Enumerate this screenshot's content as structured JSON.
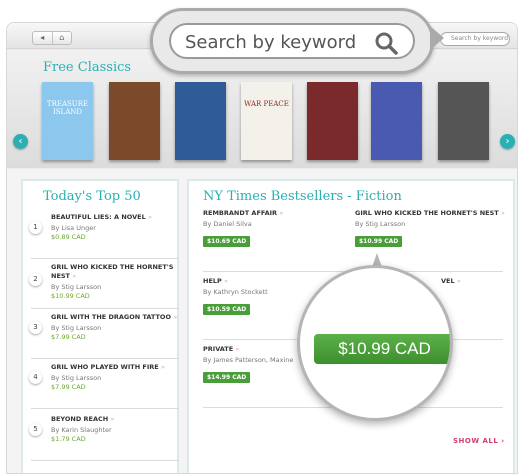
{
  "toolbar": {
    "nav_back": "◂",
    "nav_home": "⌂",
    "mini_search_placeholder": "Search by keyword"
  },
  "classics": {
    "title": "Free Classics",
    "books": [
      {
        "name": "book-cover-treasure-island",
        "text": "TREASURE ISLAND",
        "color": "#8cc7ee"
      },
      {
        "name": "book-cover-landscape",
        "text": "",
        "color": "#7a4a2a"
      },
      {
        "name": "book-cover-blue",
        "text": "",
        "color": "#2f5c97"
      },
      {
        "name": "book-cover-war-and-peace",
        "text": "WAR PEACE",
        "color": "#f4f1ea"
      },
      {
        "name": "book-cover-red-pattern",
        "text": "",
        "color": "#7a2a2a"
      },
      {
        "name": "book-cover-mosaic",
        "text": "",
        "color": "#4a5ab0"
      },
      {
        "name": "book-cover-camera-girl",
        "text": "",
        "color": "#555555"
      }
    ]
  },
  "top50": {
    "title": "Today's Top 50",
    "items": [
      {
        "num": "1",
        "title": "BEAUTIFUL LIES: A NOVEL",
        "author": "By Lisa Unger",
        "price": "$0.89 CAD"
      },
      {
        "num": "2",
        "title": "GRIL WHO KICKED THE HORNET'S NEST",
        "author": "By Stig Larsson",
        "price": "$10.99 CAD"
      },
      {
        "num": "3",
        "title": "GRIL WITH THE DRAGON TATTOO",
        "author": "By Stig Larsson",
        "price": "$7.99 CAD"
      },
      {
        "num": "4",
        "title": "GRIL WHO PLAYED WITH FIRE",
        "author": "By Stig Larsson",
        "price": "$7.99 CAD"
      },
      {
        "num": "5",
        "title": "BEYOND REACH",
        "author": "By Karin Slaughter",
        "price": "$1.79 CAD"
      }
    ]
  },
  "nyt": {
    "title": "NY Times Bestsellers - Fiction",
    "items": [
      {
        "title": "REMBRANDT AFFAIR",
        "author": "By Daniel Silva",
        "price": "$10.69 CAD"
      },
      {
        "title": "GIRL WHO KICKED THE HORNET'S NEST",
        "author": "By Stig Larsson",
        "price": "$10.99 CAD"
      },
      {
        "title": "HELP",
        "author": "By Kathryn Stockett",
        "price": "$10.59 CAD"
      },
      {
        "title": "VEL",
        "author": "",
        "price": ""
      },
      {
        "title": "PRIVATE",
        "author": "By James Patterson, Maxine",
        "price": "$14.99 CAD"
      }
    ],
    "show_all": "SHOW ALL"
  },
  "magnifiers": {
    "search_text": "Search by keyword",
    "price_text": "$10.99 CAD"
  }
}
